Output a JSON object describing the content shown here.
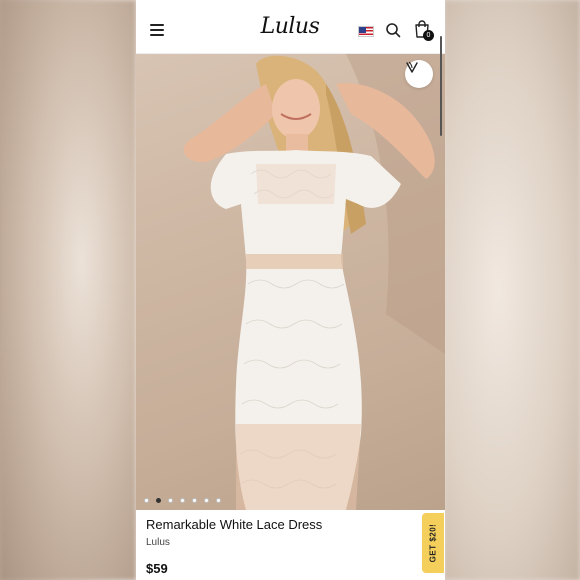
{
  "header": {
    "logo_text": "Lulus",
    "cart_count": "0",
    "icons": [
      "menu-icon",
      "us-flag-icon",
      "search-icon",
      "shopping-bag-icon"
    ]
  },
  "gallery": {
    "total_images": 7,
    "active_index": 1,
    "wishlist_icon": "heart-v-icon"
  },
  "product": {
    "title": "Remarkable White Lace Dress",
    "brand": "Lulus",
    "price": "$59"
  },
  "promo": {
    "label": "GET $20!",
    "color": "#f4cf5c"
  }
}
